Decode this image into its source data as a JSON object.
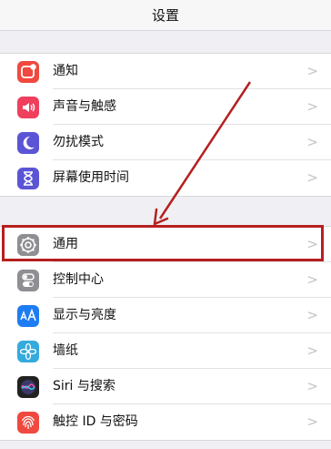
{
  "nav": {
    "title": "设置"
  },
  "group1": [
    {
      "label": "通知",
      "icon": "notifications-icon",
      "color": "#f0493f"
    },
    {
      "label": "声音与触感",
      "icon": "sound-icon",
      "color": "#ef3f5d"
    },
    {
      "label": "勿扰模式",
      "icon": "moon-icon",
      "color": "#5b55d6"
    },
    {
      "label": "屏幕使用时间",
      "icon": "hourglass-icon",
      "color": "#5b55d6"
    }
  ],
  "group2": [
    {
      "label": "通用",
      "icon": "gear-icon",
      "color": "#8e8e93"
    },
    {
      "label": "控制中心",
      "icon": "toggles-icon",
      "color": "#8e8e93"
    },
    {
      "label": "显示与亮度",
      "icon": "text-size-icon",
      "color": "#1e7cf2"
    },
    {
      "label": "墙纸",
      "icon": "flower-icon",
      "color": "#35aadc"
    },
    {
      "label": "Siri 与搜索",
      "icon": "siri-icon",
      "color": "#222222"
    },
    {
      "label": "触控 ID 与密码",
      "icon": "fingerprint-icon",
      "color": "#f0493f"
    }
  ],
  "chevron": ">",
  "annotation_color": "#b5201f"
}
